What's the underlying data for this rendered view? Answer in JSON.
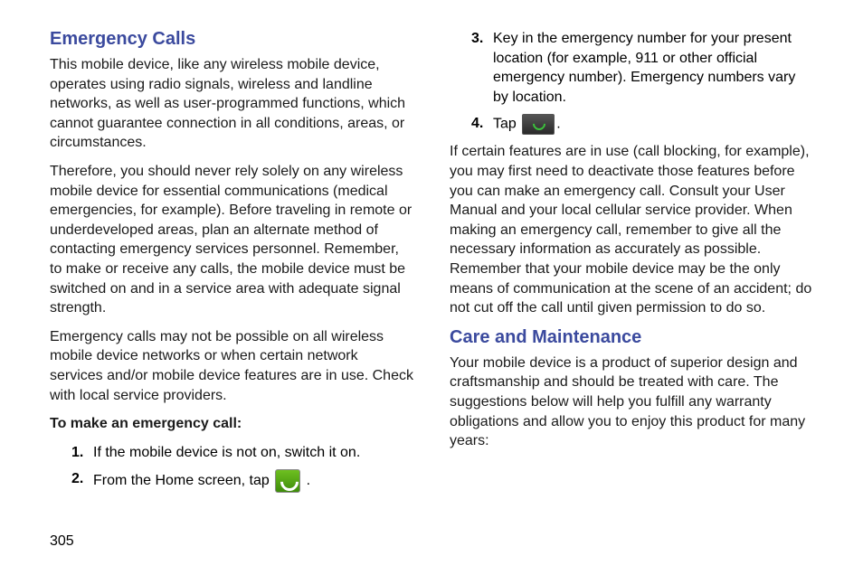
{
  "col1": {
    "heading": "Emergency Calls",
    "p1": "This mobile device, like any wireless mobile device, operates using radio signals, wireless and landline networks, as well as user-programmed functions, which cannot guarantee connection in all conditions, areas, or circumstances.",
    "p2": "Therefore, you should never rely solely on any wireless mobile device for essential communications (medical emergencies, for example). Before traveling in remote or underdeveloped areas, plan an alternate method of contacting emergency services personnel. Remember, to make or receive any calls, the mobile device must be switched on and in a service area with adequate signal strength.",
    "p3": "Emergency calls may not be possible on all wireless mobile device networks or when certain network services and/or mobile device features are in use. Check with local service providers.",
    "p4": "To make an emergency call:",
    "li1": "If the mobile device is not on, switch it on.",
    "li2a": "From the Home screen, tap ",
    "li2b": " ."
  },
  "col2": {
    "li3": "Key in the emergency number for your present location (for example, 911 or other official emergency number). Emergency numbers vary by location.",
    "li4a": "Tap ",
    "li4b": ".",
    "p1": "If certain features are in use (call blocking, for example), you may first need to deactivate those features before you can make an emergency call. Consult your User Manual and your local cellular service provider. When making an emergency call, remember to give all the necessary information as accurately as possible. Remember that your mobile device may be the only means of communication at the scene of an accident; do not cut off the call until given permission to do so.",
    "heading": "Care and Maintenance",
    "p2": "Your mobile device is a product of superior design and craftsmanship and should be treated with care. The suggestions below will help you fulfill any warranty obligations and allow you to enjoy this product for many years:"
  },
  "pageNumber": "305"
}
